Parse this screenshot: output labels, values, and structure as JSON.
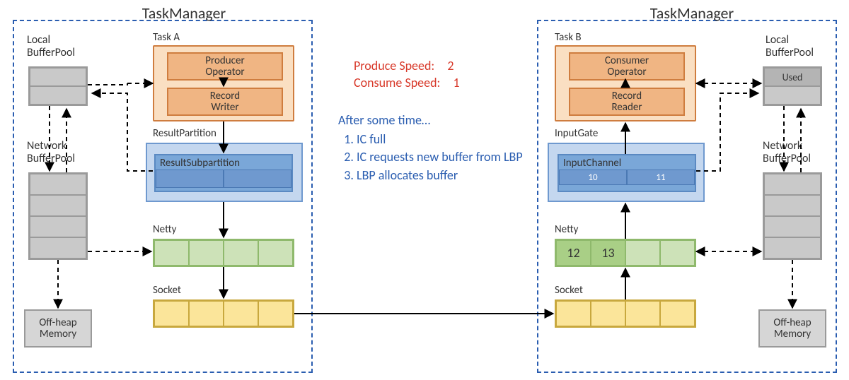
{
  "left": {
    "title": "TaskManager",
    "task": {
      "label": "Task A",
      "producer": "Producer\nOperator",
      "writer": "Record\nWriter"
    },
    "rp": {
      "label": "ResultPartition",
      "rsp": "ResultSubpartition",
      "cells": [
        "",
        ""
      ]
    },
    "netty": {
      "label": "Netty",
      "cells": [
        "",
        "",
        "",
        ""
      ]
    },
    "socket": {
      "label": "Socket",
      "cells": [
        "",
        "",
        "",
        ""
      ]
    },
    "local_bp": {
      "label": "Local\nBufferPool",
      "rows": [
        "",
        ""
      ]
    },
    "network_bp": {
      "label": "Network\nBufferPool",
      "rows": [
        "",
        "",
        "",
        ""
      ]
    },
    "offheap": "Off-heap\nMemory"
  },
  "right": {
    "title": "TaskManager",
    "task": {
      "label": "Task B",
      "consumer": "Consumer\nOperator",
      "reader": "Record\nReader"
    },
    "ig": {
      "label": "InputGate",
      "ic": "InputChannel",
      "cells": [
        "10",
        "11"
      ]
    },
    "netty": {
      "label": "Netty",
      "cells": [
        "12",
        "13",
        "",
        ""
      ]
    },
    "socket": {
      "label": "Socket",
      "cells": [
        "",
        "",
        "",
        ""
      ]
    },
    "local_bp": {
      "label": "Local\nBufferPool",
      "rows": [
        "Used",
        ""
      ]
    },
    "network_bp": {
      "label": "Network\nBufferPool",
      "rows": [
        "",
        "",
        "",
        ""
      ]
    },
    "offheap": "Off-heap\nMemory"
  },
  "center": {
    "produce_label": "Produce Speed:",
    "produce_value": "2",
    "consume_label": "Consume Speed:",
    "consume_value": "1",
    "after": "After some time…",
    "steps": [
      "IC full",
      "IC requests new buffer from LBP",
      "LBP allocates buffer"
    ]
  }
}
